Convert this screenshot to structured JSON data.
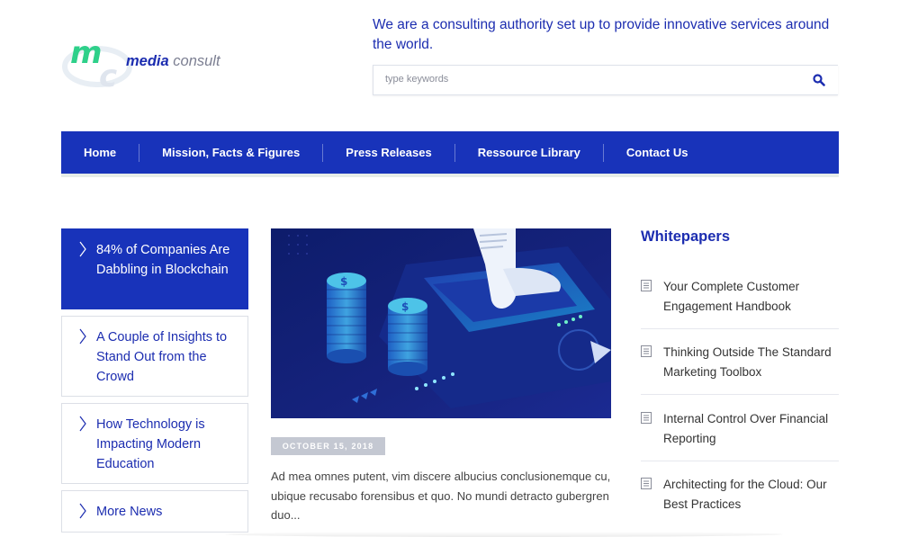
{
  "brand": {
    "logo_mark": "mc",
    "name_bold": "media",
    "name_light": "consult"
  },
  "header": {
    "tagline": "We are a consulting authority set up to provide innovative services around the world.",
    "search_placeholder": "type keywords"
  },
  "nav": {
    "items": [
      {
        "label": "Home"
      },
      {
        "label": "Mission, Facts & Figures"
      },
      {
        "label": "Press Releases"
      },
      {
        "label": "Ressource Library"
      },
      {
        "label": "Contact Us"
      }
    ]
  },
  "news": {
    "items": [
      {
        "label": "84% of Companies Are Dabbling in Blockchain",
        "active": true
      },
      {
        "label": "A Couple of Insights to Stand Out from the Crowd",
        "active": false
      },
      {
        "label": "How Technology is Impacting Modern Education",
        "active": false
      },
      {
        "label": "More News",
        "active": false
      }
    ]
  },
  "article": {
    "date": "OCTOBER 15, 2018",
    "excerpt": "Ad mea omnes putent, vim discere albucius conclusionemque cu, ubique recusabo forensibus et quo. No mundi detracto gubergren duo..."
  },
  "whitepapers": {
    "title": "Whitepapers",
    "items": [
      {
        "label": "Your Complete Customer Engagement Handbook"
      },
      {
        "label": "Thinking Outside The Standard Marketing Toolbox"
      },
      {
        "label": "Internal Control Over Financial Reporting"
      },
      {
        "label": "Architecting for the Cloud: Our Best Practices"
      }
    ]
  },
  "colors": {
    "brand_blue": "#1833ba",
    "brand_green": "#2ed08a",
    "text_blue": "#1c2db0"
  }
}
